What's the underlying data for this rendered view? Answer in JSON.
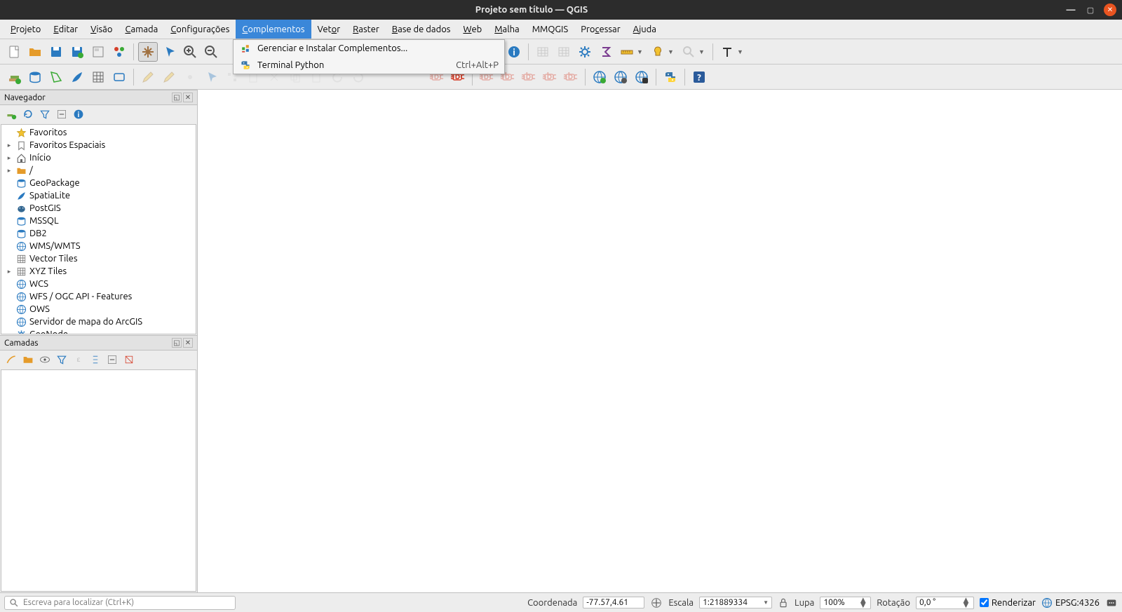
{
  "window": {
    "title": "Projeto sem título — QGIS"
  },
  "menubar": {
    "items": [
      {
        "label": "Projeto",
        "u": "P"
      },
      {
        "label": "Editar",
        "u": "E"
      },
      {
        "label": "Visão",
        "u": "V"
      },
      {
        "label": "Camada",
        "u": "C"
      },
      {
        "label": "Configurações",
        "u": "C"
      },
      {
        "label": "Complementos",
        "u": "C",
        "active": true
      },
      {
        "label": "Vetor",
        "u": "o"
      },
      {
        "label": "Raster",
        "u": "R"
      },
      {
        "label": "Base de dados",
        "u": "B"
      },
      {
        "label": "Web",
        "u": "W"
      },
      {
        "label": "Malha",
        "u": "M"
      },
      {
        "label": "MMQGIS",
        "u": ""
      },
      {
        "label": "Processar",
        "u": "c"
      },
      {
        "label": "Ajuda",
        "u": "A"
      }
    ]
  },
  "dropdown": {
    "items": [
      {
        "icon": "plugin-icon",
        "label": "Gerenciar e Instalar Complementos...",
        "shortcut": ""
      },
      {
        "icon": "python-icon",
        "label": "Terminal Python",
        "shortcut": "Ctrl+Alt+P"
      }
    ]
  },
  "browser_panel": {
    "title": "Navegador",
    "items": [
      {
        "expand": "",
        "icon": "star-icon",
        "label": "Favoritos"
      },
      {
        "expand": "▸",
        "icon": "bookmark-icon",
        "label": "Favoritos Espaciais"
      },
      {
        "expand": "▸",
        "icon": "home-icon",
        "label": "Início"
      },
      {
        "expand": "▸",
        "icon": "folder-icon",
        "label": "/"
      },
      {
        "expand": "",
        "icon": "geopackage-icon",
        "label": "GeoPackage"
      },
      {
        "expand": "",
        "icon": "feather-icon",
        "label": "SpatiaLite"
      },
      {
        "expand": "",
        "icon": "elephant-icon",
        "label": "PostGIS"
      },
      {
        "expand": "",
        "icon": "mssql-icon",
        "label": "MSSQL"
      },
      {
        "expand": "",
        "icon": "db2-icon",
        "label": "DB2"
      },
      {
        "expand": "",
        "icon": "globe-icon",
        "label": "WMS/WMTS"
      },
      {
        "expand": "",
        "icon": "grid-icon",
        "label": "Vector Tiles"
      },
      {
        "expand": "▸",
        "icon": "xyz-icon",
        "label": "XYZ Tiles"
      },
      {
        "expand": "",
        "icon": "globe-icon",
        "label": "WCS"
      },
      {
        "expand": "",
        "icon": "globe-icon",
        "label": "WFS / OGC API - Features"
      },
      {
        "expand": "",
        "icon": "globe-icon",
        "label": "OWS"
      },
      {
        "expand": "",
        "icon": "globe-icon",
        "label": "Servidor de mapa do ArcGIS"
      },
      {
        "expand": "",
        "icon": "geonode-icon",
        "label": "GeoNode"
      }
    ]
  },
  "layers_panel": {
    "title": "Camadas"
  },
  "statusbar": {
    "locator_placeholder": "Escreva para localizar (Ctrl+K)",
    "coord_label": "Coordenada",
    "coord_value": "-77.57,4.61",
    "scale_label": "Escala",
    "scale_value": "1:21889334",
    "magnifier_label": "Lupa",
    "magnifier_value": "100%",
    "rotation_label": "Rotação",
    "rotation_value": "0,0 °",
    "render_label": "Renderizar",
    "crs_label": "EPSG:4326"
  }
}
